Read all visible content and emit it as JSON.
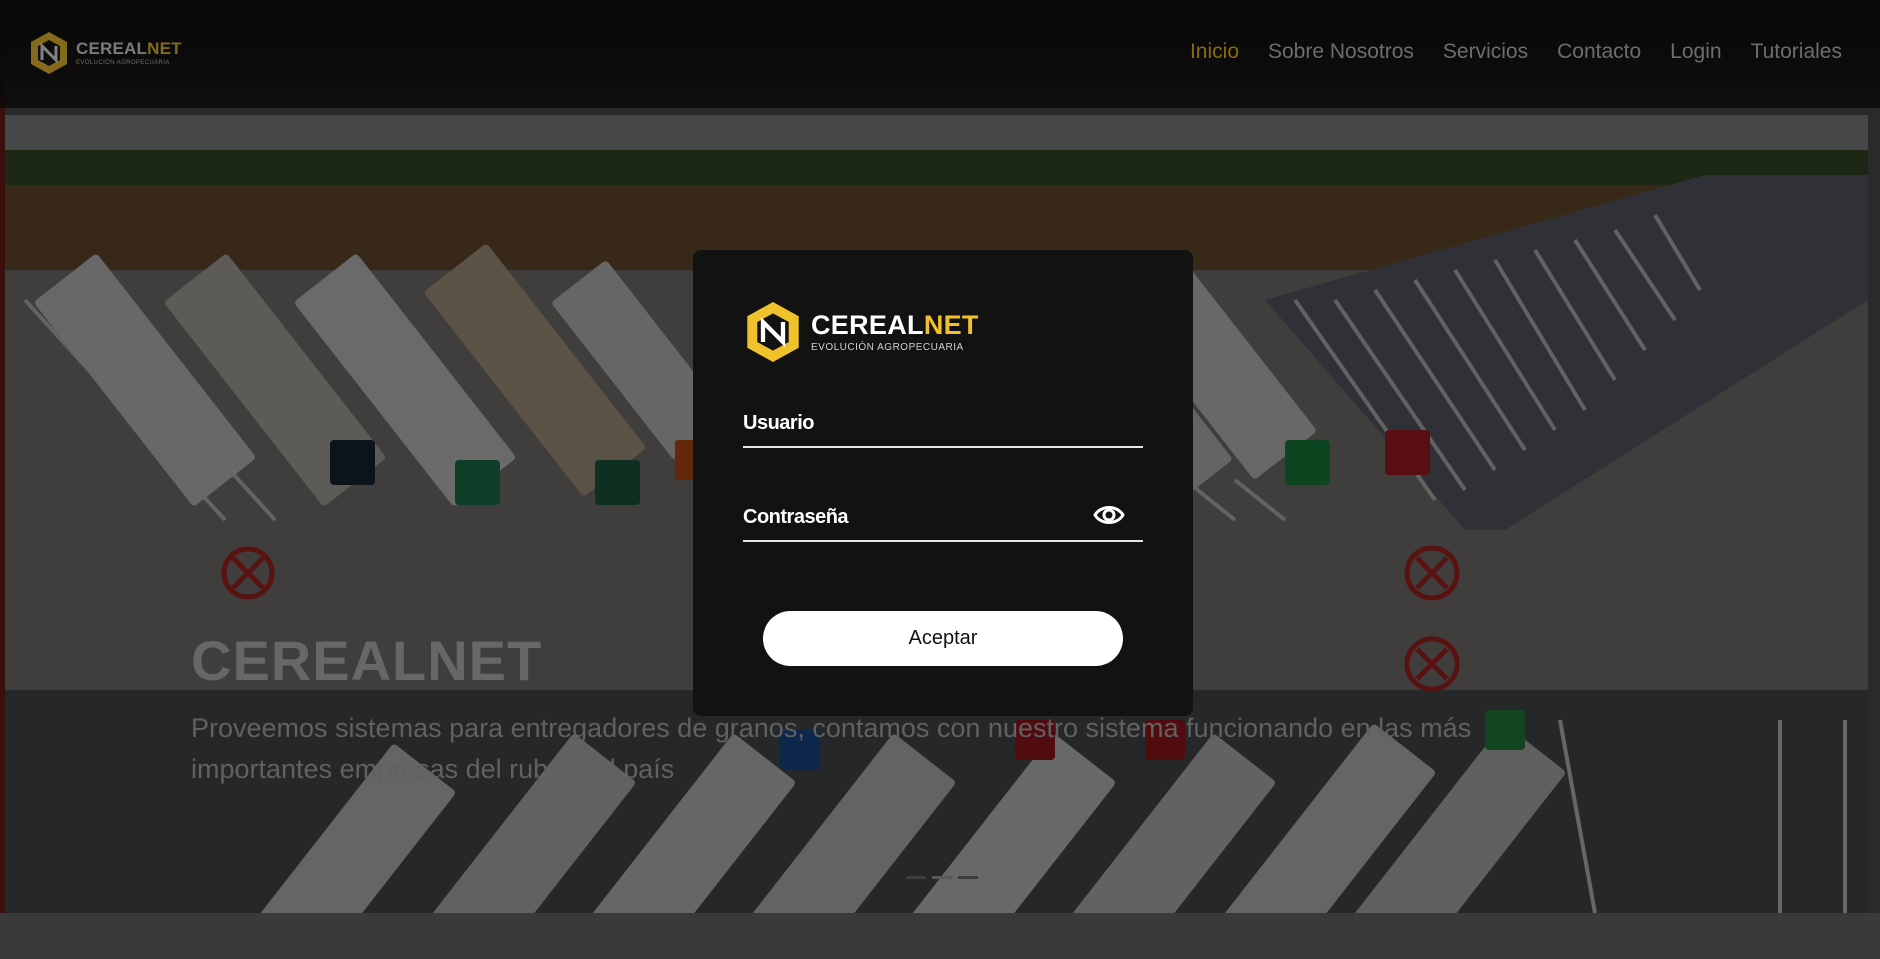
{
  "brand": {
    "name_part1": "CEREAL",
    "name_part2": "NET",
    "tagline": "EVOLUCIÓN AGROPECUARIA",
    "accent_color": "#efc12b"
  },
  "nav": {
    "items": [
      {
        "label": "Inicio",
        "active": true
      },
      {
        "label": "Sobre Nosotros",
        "active": false
      },
      {
        "label": "Servicios",
        "active": false
      },
      {
        "label": "Contacto",
        "active": false
      },
      {
        "label": "Login",
        "active": false
      },
      {
        "label": "Tutoriales",
        "active": false
      }
    ]
  },
  "hero": {
    "title": "CEREALNET",
    "description": "Proveemos sistemas para entregadores de granos, contamos con nuestro sistema funcionando en las más importantes empresas del rubro del país"
  },
  "carousel": {
    "prev_icon": "chevron-left-icon",
    "next_icon": "chevron-right-icon",
    "indicator_count": 3,
    "active_index": 1
  },
  "login": {
    "username_placeholder": "Usuario",
    "password_placeholder": "Contraseña",
    "show_password_icon": "eye-icon",
    "submit_label": "Aceptar"
  }
}
